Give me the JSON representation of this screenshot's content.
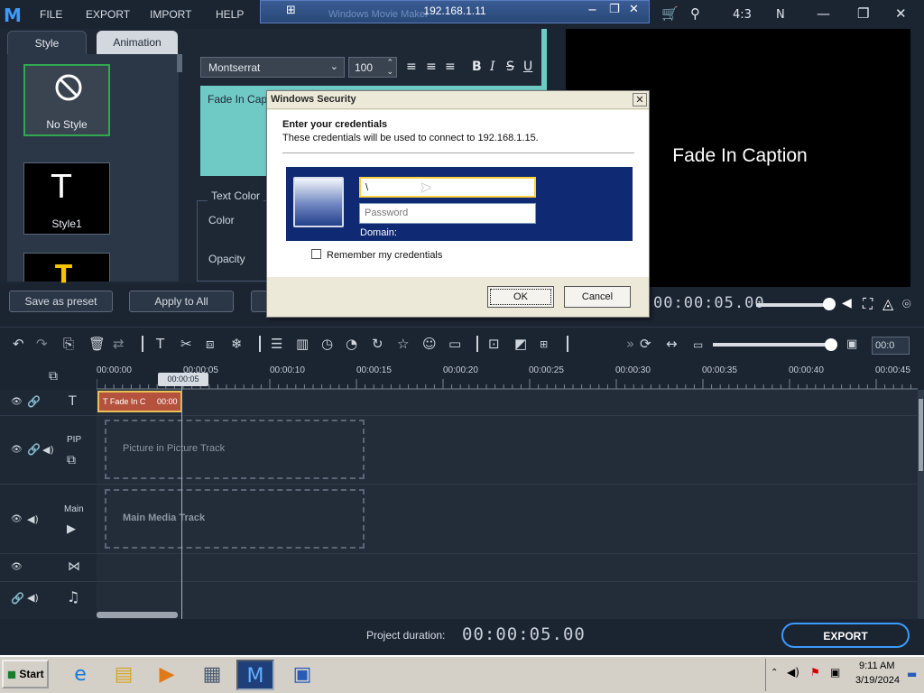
{
  "app": {
    "menu": [
      "FILE",
      "EXPORT",
      "IMPORT",
      "HELP"
    ],
    "aspect_ratio": "4:3",
    "extra": "N"
  },
  "rdp": {
    "title": "192.168.1.11",
    "background_title": "Windows Movie Maker"
  },
  "style_panel": {
    "tabs": [
      "Style",
      "Animation"
    ],
    "styles": [
      "No Style",
      "Style1"
    ]
  },
  "text_tools": {
    "font": "Montserrat",
    "size": "100",
    "caption_text": "Fade In Capt",
    "text_color_label": "Text Color",
    "color_label": "Color",
    "opacity_label": "Opacity"
  },
  "buttons": {
    "save_preset": "Save as preset",
    "apply_all": "Apply to All"
  },
  "preview": {
    "caption": "Fade In Caption",
    "timecode": "00:00:05.00"
  },
  "timeline": {
    "ruler": [
      "00:00:00",
      "00:00:05",
      "00:00:10",
      "00:00:15",
      "00:00:20",
      "00:00:25",
      "00:00:30",
      "00:00:35",
      "00:00:40",
      "00:00:45"
    ],
    "playhead": "00:00:05",
    "zoom_value": "00:0",
    "clip_label": "Fade In C",
    "clip_time": "00:00",
    "pip_label": "PIP",
    "main_label": "Main",
    "pip_placeholder": "Picture in Picture Track",
    "main_placeholder": "Main Media Track"
  },
  "footer": {
    "project_duration_label": "Project duration:",
    "project_duration": "00:00:05.00",
    "export": "EXPORT"
  },
  "dialog": {
    "title": "Windows Security",
    "heading": "Enter your credentials",
    "subtitle": "These credentials will be used to connect to 192.168.1.15.",
    "username": "\\",
    "password_placeholder": "Password",
    "domain_label": "Domain:",
    "remember": "Remember my credentials",
    "ok": "OK",
    "cancel": "Cancel"
  },
  "taskbar": {
    "start": "Start",
    "time": "9:11 AM",
    "date": "3/19/2024"
  }
}
